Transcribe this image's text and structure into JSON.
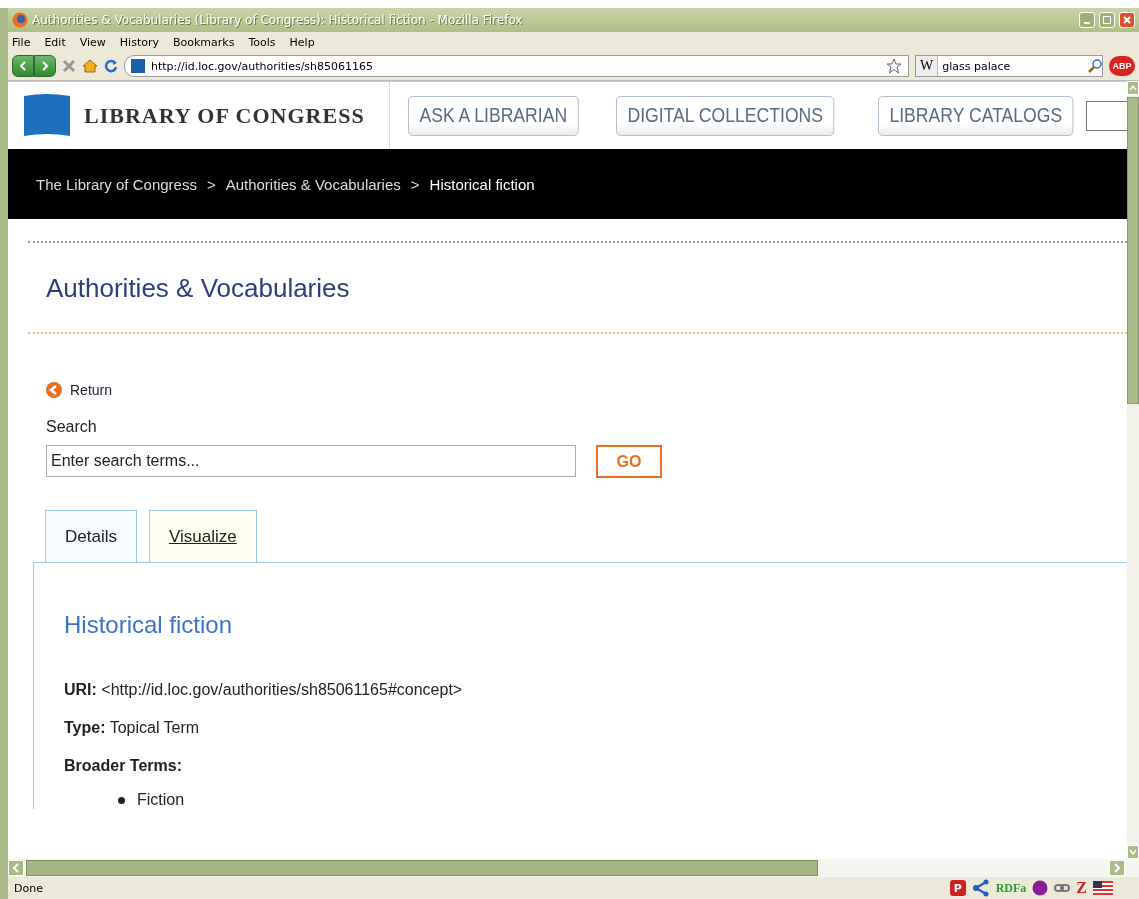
{
  "window": {
    "title": "Authorities & Vocabularies (Library of Congress): Historical fiction - Mozilla Firefox"
  },
  "menu": [
    {
      "label": "File"
    },
    {
      "label": "Edit"
    },
    {
      "label": "View"
    },
    {
      "label": "History"
    },
    {
      "label": "Bookmarks"
    },
    {
      "label": "Tools"
    },
    {
      "label": "Help"
    }
  ],
  "toolbar": {
    "url": "http://id.loc.gov/authorities/sh85061165",
    "search_engine": "W",
    "search_value": "glass palace",
    "addon": "ABP"
  },
  "header": {
    "logo": "LIBRARY OF CONGRESS",
    "buttons": [
      "ASK A LIBRARIAN",
      "DIGITAL COLLECTIONS",
      "LIBRARY CATALOGS"
    ]
  },
  "breadcrumb": [
    {
      "label": "The Library of Congress",
      "current": false
    },
    {
      "label": "Authorities & Vocabularies",
      "current": false
    },
    {
      "label": "Historical fiction",
      "current": true
    }
  ],
  "breadcrumb_separator": ">",
  "page_title": "Authorities & Vocabularies",
  "return_link": "Return",
  "search": {
    "label": "Search",
    "value": "Enter search terms...",
    "button": "GO"
  },
  "tabs": [
    {
      "label": "Details",
      "selected": true
    },
    {
      "label": "Visualize",
      "selected": false
    }
  ],
  "record": {
    "heading": "Historical fiction",
    "fields": [
      {
        "label": "URI:",
        "value": "<http://id.loc.gov/authorities/sh85061165#concept>"
      },
      {
        "label": "Type:",
        "value": "Topical Term"
      }
    ],
    "broader_label": "Broader Terms:",
    "broader_terms": [
      "Fiction"
    ]
  },
  "status_bar": {
    "text": "Done",
    "icons": [
      {
        "kind": "badge",
        "label": "P"
      },
      {
        "kind": "network"
      },
      {
        "kind": "text",
        "label": "RDFa"
      },
      {
        "kind": "orb"
      },
      {
        "kind": "link"
      },
      {
        "kind": "text",
        "label": "Z",
        "color": "#cc2222"
      },
      {
        "kind": "flag"
      }
    ]
  }
}
